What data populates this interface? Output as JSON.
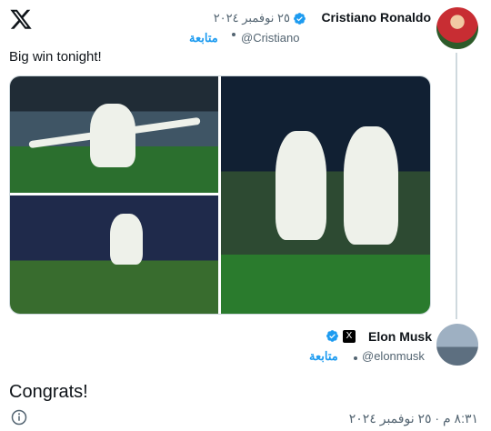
{
  "tweet": {
    "author_name": "Cristiano Ronaldo",
    "date": "٢٥ نوفمبر ٢٠٢٤",
    "handle": "@Cristiano",
    "follow_label": "متابعة",
    "text": "Big win tonight!",
    "photos": [
      "photo-1",
      "photo-2",
      "photo-3"
    ]
  },
  "reply": {
    "author_name": "Elon Musk",
    "badge_label": "X",
    "handle": "@elonmusk",
    "follow_label": "متابعة",
    "text": "Congrats!",
    "timestamp": "٨:٣١ م · ٢٥ نوفمبر ٢٠٢٤"
  },
  "colors": {
    "accent": "#1d9bf0",
    "secondary_text": "#536471",
    "divider": "#cfd9de"
  },
  "icons": {
    "logo": "x-logo-icon",
    "verified": "verified-badge-icon",
    "info": "info-icon"
  }
}
